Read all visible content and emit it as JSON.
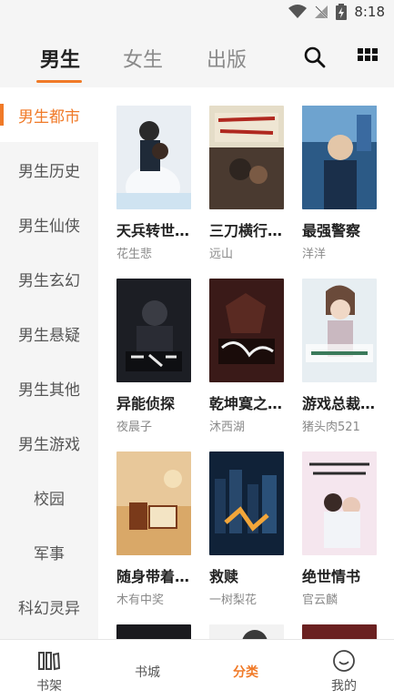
{
  "status_bar": {
    "time": "8:18"
  },
  "top_tabs": [
    {
      "label": "男生",
      "active": true
    },
    {
      "label": "女生",
      "active": false
    },
    {
      "label": "出版",
      "active": false
    }
  ],
  "header_icons": [
    "search-icon",
    "grid-icon"
  ],
  "sidebar": {
    "items": [
      {
        "label": "男生都市",
        "active": true
      },
      {
        "label": "男生历史"
      },
      {
        "label": "男生仙侠"
      },
      {
        "label": "男生玄幻"
      },
      {
        "label": "男生悬疑"
      },
      {
        "label": "男生其他"
      },
      {
        "label": "男生游戏"
      },
      {
        "label": "校园"
      },
      {
        "label": "军事"
      },
      {
        "label": "科幻灵异"
      }
    ]
  },
  "books": [
    {
      "title": "天兵转世…",
      "author": "花生悲"
    },
    {
      "title": "三刀横行…",
      "author": "远山"
    },
    {
      "title": "最强警察",
      "author": "洋洋"
    },
    {
      "title": "异能侦探",
      "author": "夜晨子"
    },
    {
      "title": "乾坤寞之…",
      "author": "沐西湖"
    },
    {
      "title": "游戏总裁…",
      "author": "猪头肉521"
    },
    {
      "title": "随身带着…",
      "author": "木有中奖"
    },
    {
      "title": "救赎",
      "author": "一树梨花"
    },
    {
      "title": "绝世情书",
      "author": "官云麟"
    }
  ],
  "bottom_nav": [
    {
      "label": "书架",
      "icon": "bookshelf-icon"
    },
    {
      "label": "书城",
      "icon": ""
    },
    {
      "label": "分类",
      "icon": "",
      "active": true
    },
    {
      "label": "我的",
      "icon": "smiley-icon"
    }
  ],
  "colors": {
    "accent": "#f07a28",
    "sidebar_bg": "#f5f5f5"
  }
}
